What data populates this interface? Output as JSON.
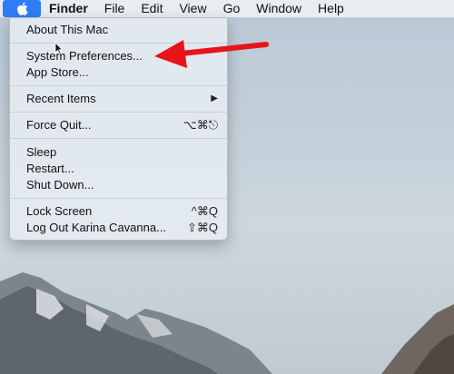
{
  "menubar": {
    "apple_icon": "apple-logo",
    "items": [
      "Finder",
      "File",
      "Edit",
      "View",
      "Go",
      "Window",
      "Help"
    ]
  },
  "apple_menu": {
    "items": [
      {
        "label": "About This Mac",
        "shortcut": ""
      },
      {
        "label": "System Preferences...",
        "shortcut": ""
      },
      {
        "label": "App Store...",
        "shortcut": ""
      },
      {
        "label": "Recent Items",
        "shortcut": "▶"
      },
      {
        "label": "Force Quit...",
        "shortcut": "⌥⌘⎋"
      },
      {
        "label": "Sleep",
        "shortcut": ""
      },
      {
        "label": "Restart...",
        "shortcut": ""
      },
      {
        "label": "Shut Down...",
        "shortcut": ""
      },
      {
        "label": "Lock Screen",
        "shortcut": "^⌘Q"
      },
      {
        "label": "Log Out Karina Cavanna...",
        "shortcut": "⇧⌘Q"
      }
    ]
  },
  "annotation": {
    "arrow_color": "#e8141b"
  }
}
